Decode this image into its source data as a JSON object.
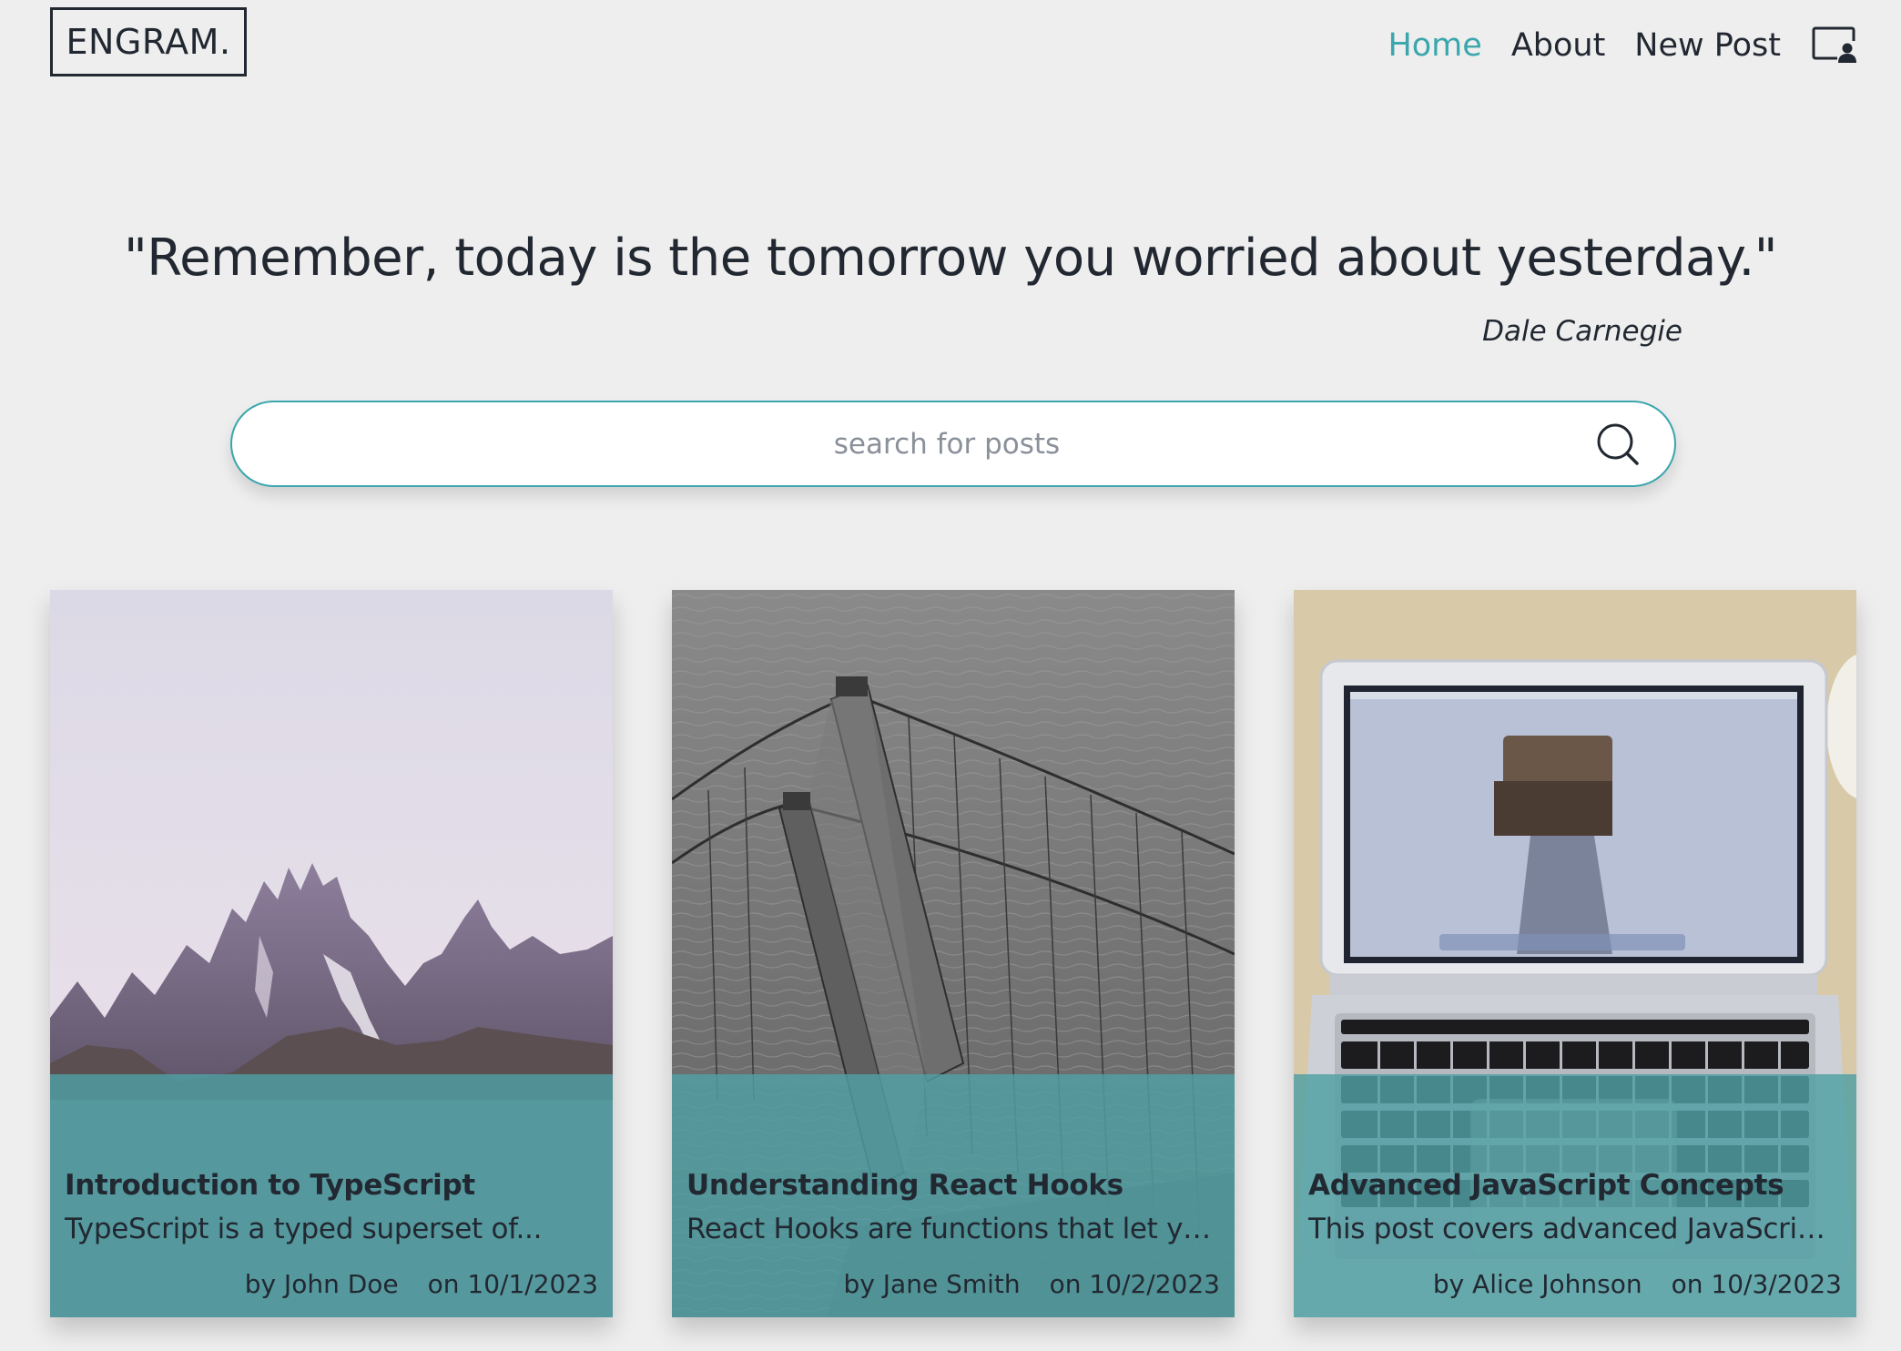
{
  "brand": {
    "logo_text": "ENGRAM."
  },
  "nav": {
    "items": [
      {
        "label": "Home",
        "active": true
      },
      {
        "label": "About",
        "active": false
      },
      {
        "label": "New Post",
        "active": false
      }
    ],
    "profile_icon": "profile-card-icon"
  },
  "quote": {
    "text": "\"Remember, today is the tomorrow you worried about yesterday.\"",
    "author": "Dale Carnegie"
  },
  "search": {
    "placeholder": "search for posts",
    "value": "",
    "icon": "search-icon"
  },
  "posts": [
    {
      "title": "Introduction to TypeScript",
      "excerpt": "TypeScript is a typed superset of...",
      "author": "by John Doe",
      "date": "on 10/1/2023",
      "image": "mountain-peaks"
    },
    {
      "title": "Understanding React Hooks",
      "excerpt": "React Hooks are functions that let you u...",
      "author": "by Jane Smith",
      "date": "on 10/2/2023",
      "image": "suspension-bridge-tower"
    },
    {
      "title": "Advanced JavaScript Concepts",
      "excerpt": "This post covers advanced JavaScript...",
      "author": "by Alice Johnson",
      "date": "on 10/3/2023",
      "image": "laptop-on-desk"
    }
  ],
  "colors": {
    "background": "#eeeeee",
    "text": "#222831",
    "accent": "#3aa6ad",
    "card_overlay": "#4fa0a3"
  }
}
